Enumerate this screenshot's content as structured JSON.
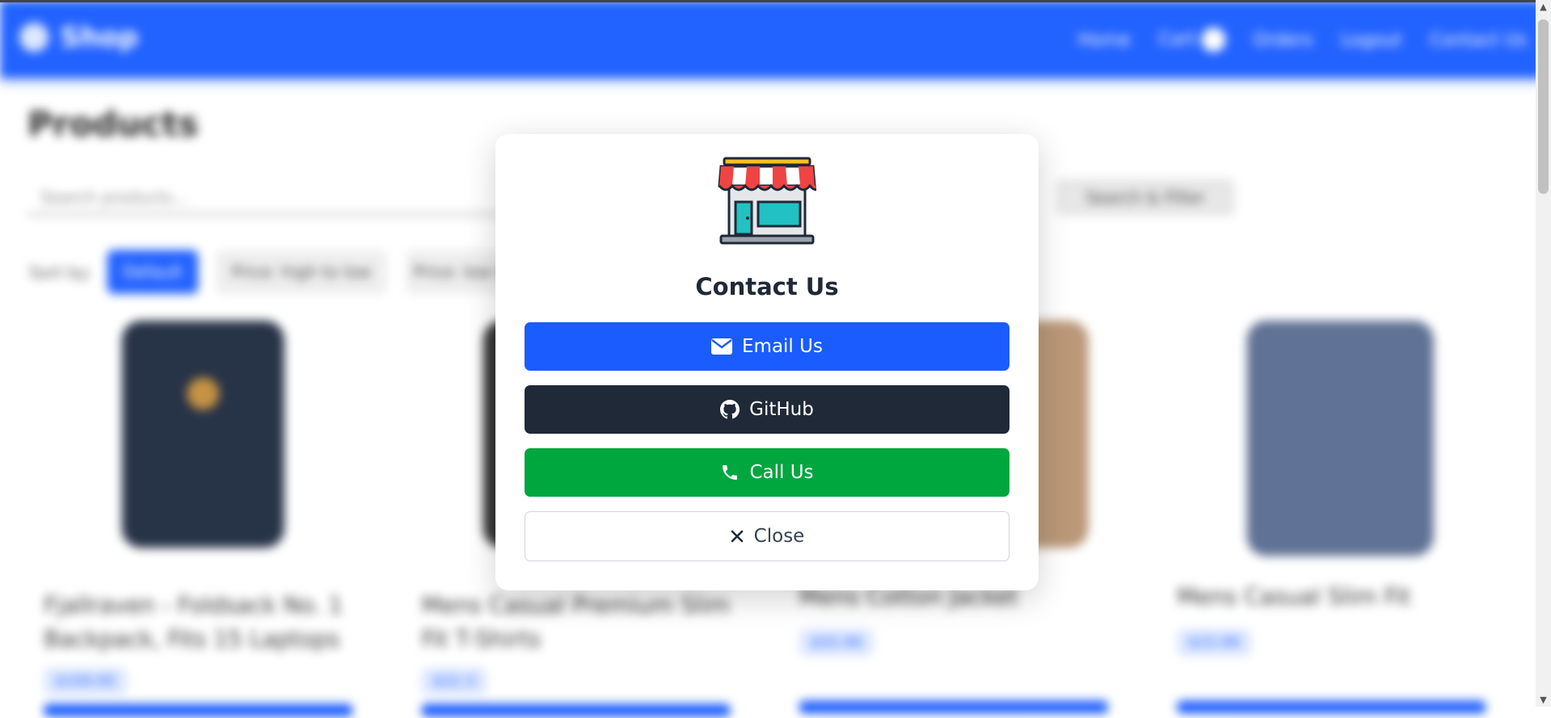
{
  "background": {
    "nav": {
      "brand": "Shop",
      "links": [
        "Home",
        "Cart",
        "Orders",
        "Logout",
        "Contact Us"
      ]
    },
    "page_title": "Products",
    "search_placeholder": "Search products...",
    "filter_button": "Search & Filter",
    "sort": {
      "label": "Sort by:",
      "options": [
        "Default",
        "Price: high to low",
        "Price: low to high"
      ]
    },
    "products": [
      {
        "title": "Fjallraven - Foldsack No. 1 Backpack, Fits 15 Laptops",
        "price": "$109.95"
      },
      {
        "title": "Mens Casual Premium Slim Fit T-Shirts",
        "price": "$22.3"
      },
      {
        "title": "Mens Cotton Jacket",
        "price": "$55.99"
      },
      {
        "title": "Mens Casual Slim Fit",
        "price": "$15.99"
      }
    ]
  },
  "modal": {
    "title": "Contact Us",
    "buttons": {
      "email": "Email Us",
      "github": "GitHub",
      "call": "Call Us",
      "close": "Close"
    }
  },
  "colors": {
    "primary": "#1a5cff",
    "dark": "#1f2937",
    "success": "#00a63e"
  }
}
